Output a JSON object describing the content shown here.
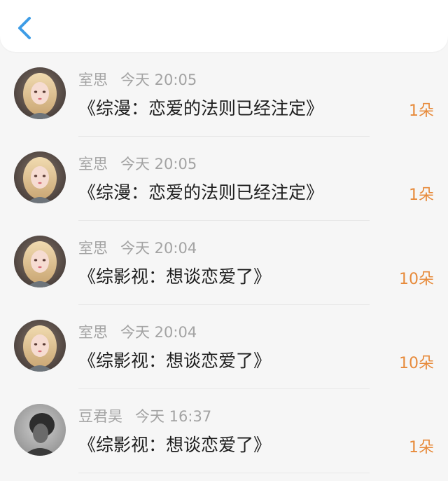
{
  "colors": {
    "accent": "#3d9ce6",
    "amount": "#e78a3a"
  },
  "header": {
    "back_icon": "chevron-left-icon"
  },
  "records": [
    {
      "name": "室思",
      "time": "今天 20:05",
      "title": "《综漫：恋爱的法则已经注定》",
      "amount": "1朵",
      "avatar": "girl-avatar"
    },
    {
      "name": "室思",
      "time": "今天 20:05",
      "title": "《综漫：恋爱的法则已经注定》",
      "amount": "1朵",
      "avatar": "girl-avatar"
    },
    {
      "name": "室思",
      "time": "今天 20:04",
      "title": "《综影视：想谈恋爱了》",
      "amount": "10朵",
      "avatar": "girl-avatar"
    },
    {
      "name": "室思",
      "time": "今天 20:04",
      "title": "《综影视：想谈恋爱了》",
      "amount": "10朵",
      "avatar": "girl-avatar"
    },
    {
      "name": "豆君昊",
      "time": "今天 16:37",
      "title": "《综影视：想谈恋爱了》",
      "amount": "1朵",
      "avatar": "boy-avatar"
    }
  ]
}
